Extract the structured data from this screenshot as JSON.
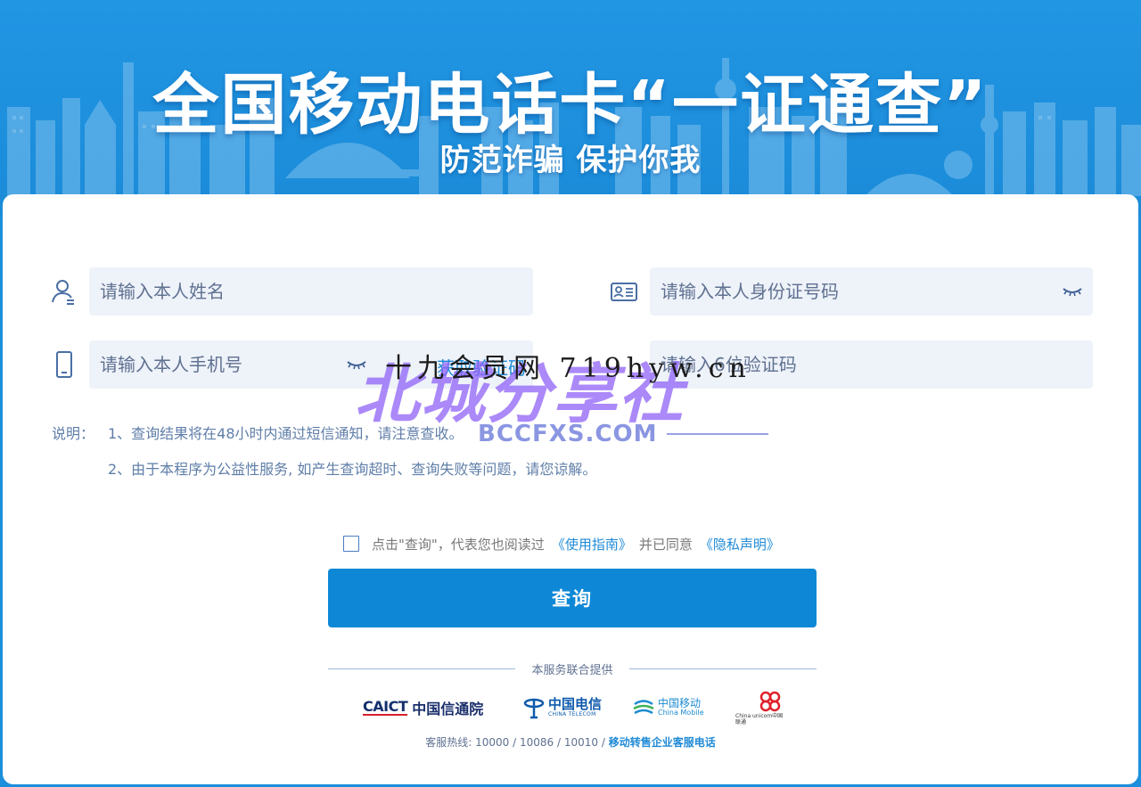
{
  "banner": {
    "title": "全国移动电话卡“一证通查”",
    "subtitle": "防范诈骗 保护你我"
  },
  "form": {
    "name_placeholder": "请输入本人姓名",
    "id_placeholder": "请输入本人身份证号码",
    "phone_placeholder": "请输入本人手机号",
    "code_placeholder": "请输入6位验证码",
    "get_code_label": "获取验证码"
  },
  "notes": {
    "label": "说明：",
    "lines": [
      "1、查询结果将在48小时内通过短信通知，请注意查收。",
      "2、由于本程序为公益性服务, 如产生查询超时、查询失败等问题，请您谅解。"
    ]
  },
  "agreement": {
    "prefix": "点击\"查询\"，代表您也阅读过",
    "guide_link": "《使用指南》",
    "middle": "并已同意",
    "privacy_link": "《隐私声明》"
  },
  "query_button": "查询",
  "providers": {
    "label": "本服务联合提供",
    "caict_en": "CAICT",
    "caict_cn": "中国信通院",
    "telecom_cn": "中国电信",
    "telecom_en": "CHINA TELECOM",
    "mobile_cn": "中国移动",
    "mobile_en": "China Mobile",
    "unicom_text": "China unicom中国联通"
  },
  "hotline": {
    "text": "客服热线: 10000 / 10086 / 10010 / ",
    "link": "移动转售企业客服电话"
  },
  "watermark": {
    "big": "北城分享社",
    "mid": "十九会员网  719hyw.cn",
    "url": "BCCFXS.COM"
  },
  "colors": {
    "brand_blue": "#0e88d6",
    "banner_blue": "#1b8fdc",
    "field_bg": "#eef2f9",
    "link_blue": "#1e8ad6"
  }
}
